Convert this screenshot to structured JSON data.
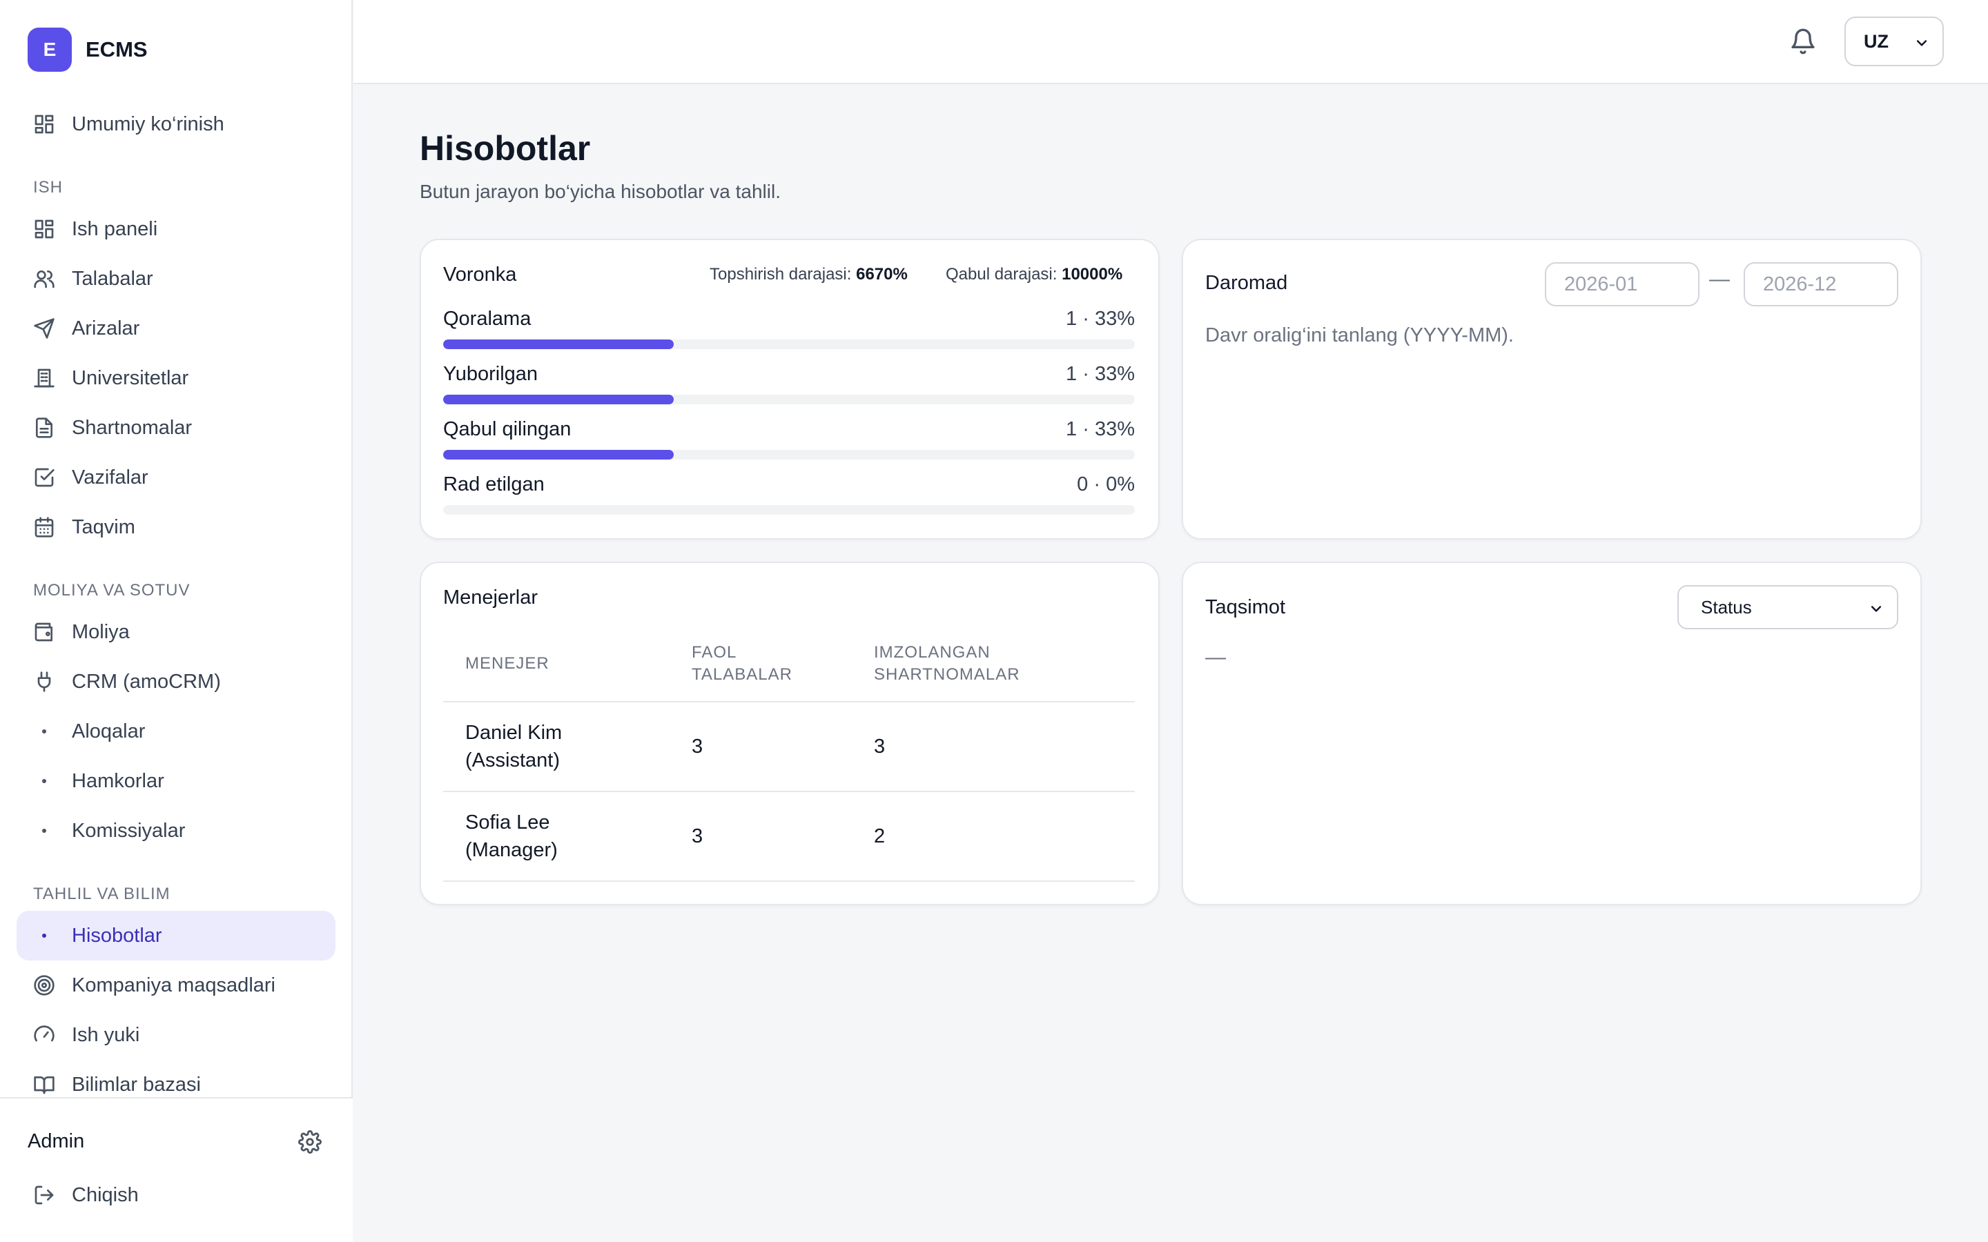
{
  "brand": {
    "initial": "E",
    "name": "ECMS"
  },
  "sidebar": {
    "overview": "Umumiy ko‘rinish",
    "sections": {
      "work": "ISH",
      "finance": "MOLIYA VA SOTUV",
      "analysis": "TAHLIL VA BILIM"
    },
    "work_items": [
      "Ish paneli",
      "Talabalar",
      "Arizalar",
      "Universitetlar",
      "Shartnomalar",
      "Vazifalar",
      "Taqvim"
    ],
    "finance_items": [
      "Moliya",
      "CRM (amoCRM)",
      "Aloqalar",
      "Hamkorlar",
      "Komissiyalar"
    ],
    "analysis_items": [
      "Hisobotlar",
      "Kompaniya maqsadlari",
      "Ish yuki",
      "Bilimlar bazasi"
    ],
    "active_item": "Hisobotlar",
    "user": "Admin",
    "logout": "Chiqish"
  },
  "topbar": {
    "language": "UZ"
  },
  "page": {
    "title": "Hisobotlar",
    "subtitle": "Butun jarayon bo‘yicha hisobotlar va tahlil."
  },
  "funnel": {
    "title": "Voronka",
    "submit_rate_label": "Topshirish darajasi:",
    "submit_rate_value": "6670%",
    "accept_rate_label": "Qabul darajasi:",
    "accept_rate_value": "10000%",
    "rows": [
      {
        "label": "Qoralama",
        "value": "1 · 33%",
        "fraction": 0.333
      },
      {
        "label": "Yuborilgan",
        "value": "1 · 33%",
        "fraction": 0.333
      },
      {
        "label": "Qabul qilingan",
        "value": "1 · 33%",
        "fraction": 0.333
      },
      {
        "label": "Rad etilgan",
        "value": "0 · 0%",
        "fraction": 0
      }
    ]
  },
  "revenue": {
    "title": "Daromad",
    "from_placeholder": "2026-01",
    "separator": "—",
    "to_placeholder": "2026-12",
    "hint": "Davr oralig‘ini tanlang (YYYY-MM)."
  },
  "managers": {
    "title": "Menejerlar",
    "columns": [
      "MENEJER",
      "FAOL\nTALABALAR",
      "IMZOLANGAN\nSHARTNOMALAR"
    ],
    "rows": [
      {
        "name": "Daniel Kim\n(Assistant)",
        "active_students": "3",
        "signed_contracts": "3"
      },
      {
        "name": "Sofia Lee\n(Manager)",
        "active_students": "3",
        "signed_contracts": "2"
      }
    ]
  },
  "distribution": {
    "title": "Taqsimot",
    "selected": "Status",
    "empty": "—"
  },
  "colors": {
    "accent": "#5b4fe9",
    "active_bg": "#ecebfd",
    "active_text": "#3b2fb8"
  }
}
